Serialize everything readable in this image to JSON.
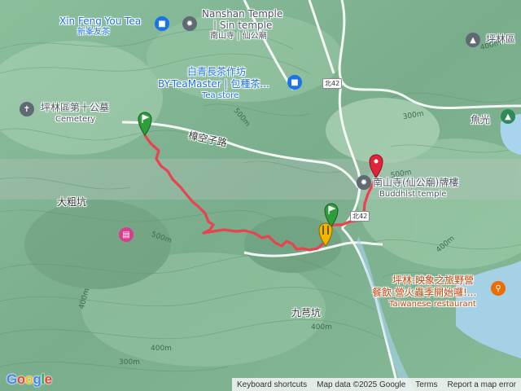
{
  "map": {
    "pois": {
      "xin_feng": {
        "name": "Xin Feng You Tea",
        "sub": "新峯友茶"
      },
      "nanshan": {
        "name": "Nanshan Temple",
        "line2": "| Sin temple",
        "sub": "南山寺 | 仙公廟"
      },
      "pinglin_top": {
        "name": "坪林區"
      },
      "baiqing": {
        "line1": "白青長茶作坊",
        "line2": "BY-TeaMaster | 包種茶...",
        "sub": "Tea store"
      },
      "cemetery": {
        "name": "坪林區第十公墓",
        "sub": "Cemetery"
      },
      "gate": {
        "name": "南山寺(仙公廟)牌樓",
        "sub": "Buddhist temple"
      },
      "yuguang": {
        "name": "魚光"
      },
      "camp": {
        "line1": "坪林:映象之旅野營",
        "line2": "餐飲:營火蟲季開始囉!...",
        "sub": "Taiwanese restaurant"
      }
    },
    "places": {
      "dacukeng": "大粗坑",
      "jiuqiongkeng": "九芎坑",
      "road": "樟空子路"
    },
    "route_badges": {
      "north42": "北42",
      "partial": "北42"
    },
    "contours": [
      "500m",
      "500m",
      "400m",
      "300m",
      "400m",
      "400m",
      "500m",
      "400m",
      "400m",
      "300m"
    ],
    "track_color": "#e8434e",
    "colors": {
      "blue_poi": "#1a73e8",
      "orange_poi": "#ef6c00",
      "start_pin": "#2e9e3a",
      "end_pin": "#e0253a",
      "mid_pin": "#f2b400",
      "water": "#a8d4ee"
    }
  },
  "google": {
    "logo": "Google"
  },
  "attribution": {
    "shortcuts": "Keyboard shortcuts",
    "mapdata": "Map data ©2025 Google",
    "terms": "Terms",
    "report": "Report a map error"
  }
}
